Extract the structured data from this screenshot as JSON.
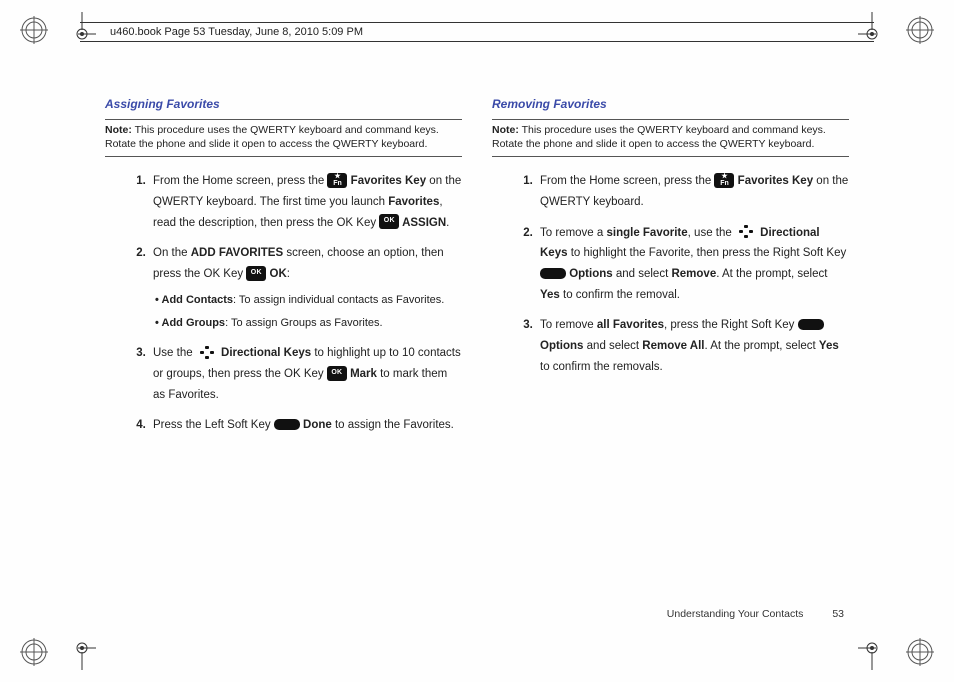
{
  "header": {
    "crop_text": "u460.book  Page 53  Tuesday, June 8, 2010  5:09 PM"
  },
  "left": {
    "title": "Assigning Favorites",
    "note_label": "Note:",
    "note_text": " This procedure uses the QWERTY keyboard and command keys. Rotate the phone and slide it open to access the QWERTY keyboard.",
    "s1a": "From the Home screen, press the ",
    "s1b": " Favorites Key",
    "s1c": " on the QWERTY keyboard. The first time you launch ",
    "s1d": "Favorites",
    "s1e": ", read the description, then press the OK Key ",
    "s1f": " ASSIGN",
    "s1g": ".",
    "s2a": "On the ",
    "s2b": "ADD FAVORITES",
    "s2c": " screen, choose an option, then press the OK Key ",
    "s2d": " OK",
    "s2e": ":",
    "bul1a": "Add Contacts",
    "bul1b": ": To assign individual contacts as Favorites.",
    "bul2a": "Add Groups",
    "bul2b": ": To assign Groups as Favorites.",
    "s3a": "Use the ",
    "s3b": " Directional Keys",
    "s3c": " to highlight up to 10 contacts or groups, then press the OK Key ",
    "s3d": " Mark",
    "s3e": " to mark them as Favorites.",
    "s4a": "Press the Left Soft Key ",
    "s4b": " Done",
    "s4c": " to assign the Favorites."
  },
  "right": {
    "title": "Removing Favorites",
    "note_label": "Note:",
    "note_text": " This procedure uses the QWERTY keyboard and command keys. Rotate the phone and slide it open to access the QWERTY keyboard.",
    "s1a": "From the Home screen, press the ",
    "s1b": " Favorites Key",
    "s1c": " on the QWERTY keyboard.",
    "s2a": "To remove a ",
    "s2b": "single Favorite",
    "s2c": ", use the ",
    "s2d": " Directional Keys",
    "s2e": " to highlight the Favorite, then press the Right Soft Key ",
    "s2f": " Options",
    "s2g": " and select ",
    "s2h": "Remove",
    "s2i": ". At the prompt, select ",
    "s2j": "Yes",
    "s2k": " to confirm the removal.",
    "s3a": "To remove ",
    "s3b": "all Favorites",
    "s3c": ", press the Right Soft Key ",
    "s3d": " Options",
    "s3e": " and select ",
    "s3f": "Remove All",
    "s3g": ". At the prompt, select ",
    "s3h": "Yes",
    "s3i": " to confirm the removals."
  },
  "footer": {
    "chapter": "Understanding Your Contacts",
    "page": "53"
  },
  "icons": {
    "fn_top": "★",
    "fn_bot": "Fn",
    "ok": "OK"
  }
}
